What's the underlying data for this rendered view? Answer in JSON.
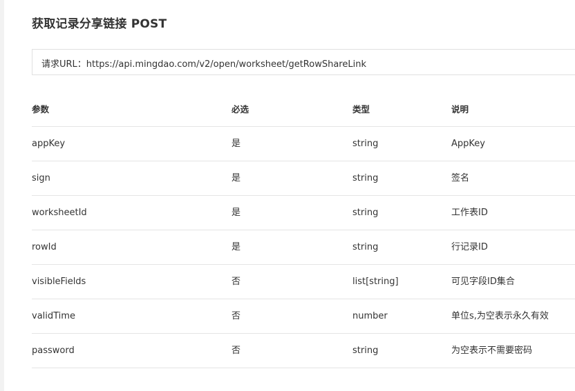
{
  "page": {
    "title": "获取记录分享链接 POST",
    "request_url": "请求URL：https://api.mingdao.com/v2/open/worksheet/getRowShareLink"
  },
  "table": {
    "headers": {
      "param": "参数",
      "required": "必选",
      "type": "类型",
      "desc": "说明"
    },
    "rows": [
      {
        "param": "appKey",
        "required": "是",
        "type": "string",
        "desc": "AppKey"
      },
      {
        "param": "sign",
        "required": "是",
        "type": "string",
        "desc": "签名"
      },
      {
        "param": "worksheetId",
        "required": "是",
        "type": "string",
        "desc": "工作表ID"
      },
      {
        "param": "rowId",
        "required": "是",
        "type": "string",
        "desc": "行记录ID"
      },
      {
        "param": "visibleFields",
        "required": "否",
        "type": "list[string]",
        "desc": "可见字段ID集合"
      },
      {
        "param": "validTime",
        "required": "否",
        "type": "number",
        "desc": "单位s,为空表示永久有效"
      },
      {
        "param": "password",
        "required": "否",
        "type": "string",
        "desc": "为空表示不需要密码"
      }
    ]
  }
}
